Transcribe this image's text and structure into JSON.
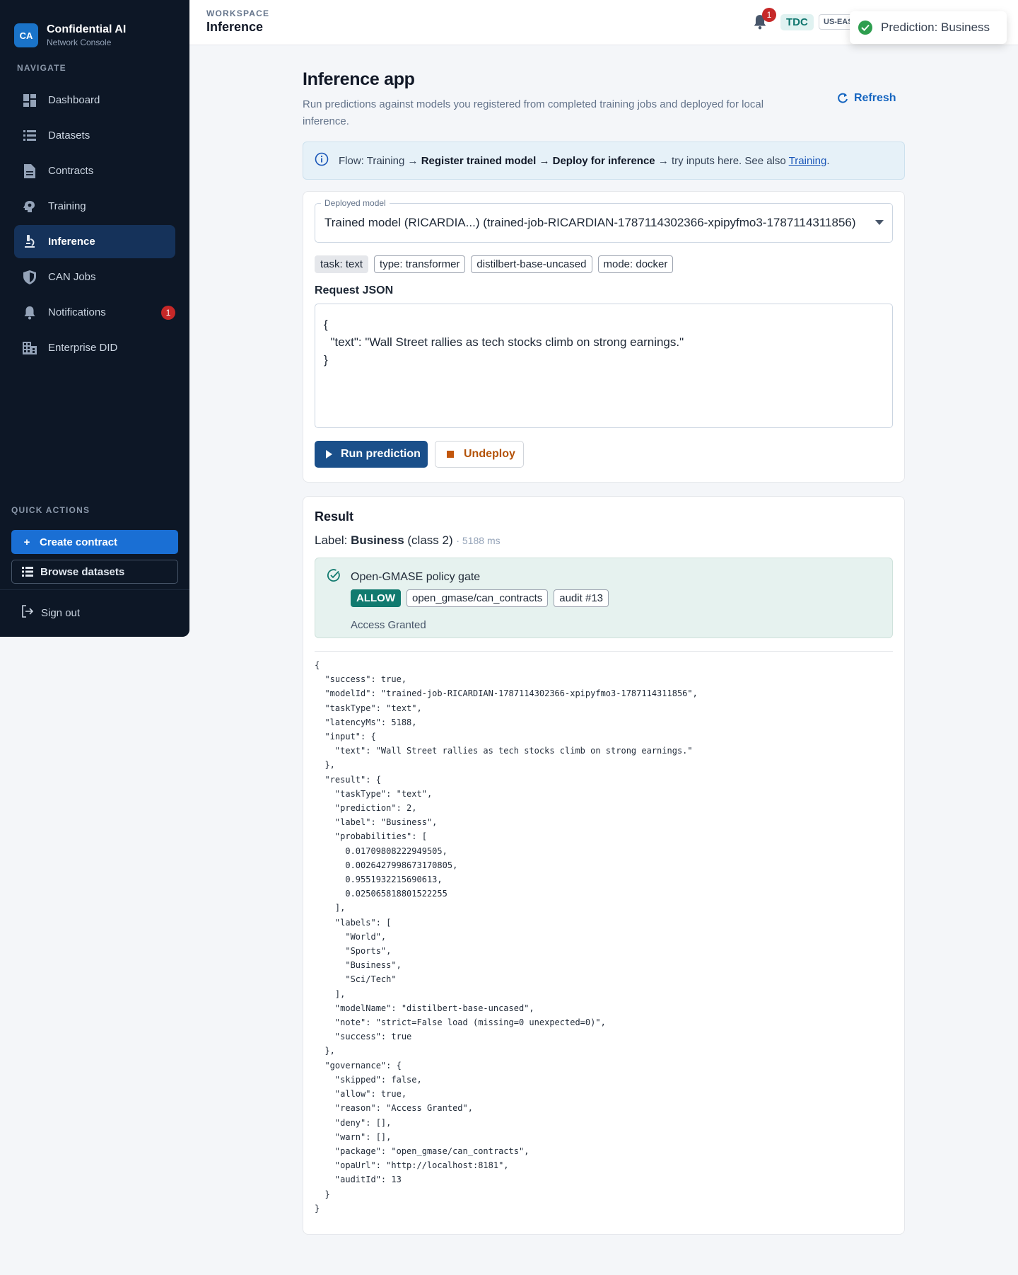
{
  "sidebar": {
    "logo": "CA",
    "brand_title": "Confidential AI",
    "brand_sub": "Network Console",
    "nav_label": "NAVIGATE",
    "items": [
      {
        "label": "Dashboard",
        "icon": "dashboard-icon"
      },
      {
        "label": "Datasets",
        "icon": "list-icon"
      },
      {
        "label": "Contracts",
        "icon": "document-icon"
      },
      {
        "label": "Training",
        "icon": "brain-icon"
      },
      {
        "label": "Inference",
        "icon": "microscope-icon",
        "active": true
      },
      {
        "label": "CAN Jobs",
        "icon": "shield-icon"
      },
      {
        "label": "Notifications",
        "icon": "bell-icon",
        "badge": "1"
      },
      {
        "label": "Enterprise DID",
        "icon": "building-icon"
      }
    ],
    "quick_actions_label": "QUICK ACTIONS",
    "create_contract": "Create contract",
    "browse_datasets": "Browse datasets",
    "sign_out": "Sign out"
  },
  "topbar": {
    "workspace_label": "WORKSPACE",
    "workspace_title": "Inference",
    "notification_count": "1",
    "org": "TDC",
    "region": "US-EAST"
  },
  "toast": {
    "text": "Prediction: Business"
  },
  "page": {
    "title": "Inference app",
    "description": "Run predictions against models you registered from completed training jobs and deployed for local inference.",
    "refresh": "Refresh",
    "flow": {
      "prefix": "Flow: Training →",
      "step1": "Register trained model",
      "arrow": "→",
      "step2": "Deploy for inference",
      "suffix": "→ try inputs here. See also",
      "link": "Training",
      "end": "."
    }
  },
  "model": {
    "legend": "Deployed model",
    "selected": "Trained model (RICARDIA...) (trained-job-RICARDIAN-1787114302366-xpipyfmo3-1787114311856)",
    "chips": [
      "task: text",
      "type: transformer",
      "distilbert-base-uncased",
      "mode: docker"
    ]
  },
  "request": {
    "label": "Request JSON",
    "body": "{\n  \"text\": \"Wall Street rallies as tech stocks climb on strong earnings.\"\n}"
  },
  "actions": {
    "run": "Run prediction",
    "undeploy": "Undeploy"
  },
  "result": {
    "title": "Result",
    "label_prefix": "Label:",
    "label": "Business",
    "class": "(class 2)",
    "latency": "· 5188 ms",
    "policy": {
      "title": "Open-GMASE policy gate",
      "decision": "ALLOW",
      "package": "open_gmase/can_contracts",
      "audit": "audit #13",
      "reason": "Access Granted"
    },
    "json": "{\n  \"success\": true,\n  \"modelId\": \"trained-job-RICARDIAN-1787114302366-xpipyfmo3-1787114311856\",\n  \"taskType\": \"text\",\n  \"latencyMs\": 5188,\n  \"input\": {\n    \"text\": \"Wall Street rallies as tech stocks climb on strong earnings.\"\n  },\n  \"result\": {\n    \"taskType\": \"text\",\n    \"prediction\": 2,\n    \"label\": \"Business\",\n    \"probabilities\": [\n      0.01709808222949505,\n      0.0026427998673170805,\n      0.9551932215690613,\n      0.025065818801522255\n    ],\n    \"labels\": [\n      \"World\",\n      \"Sports\",\n      \"Business\",\n      \"Sci/Tech\"\n    ],\n    \"modelName\": \"distilbert-base-uncased\",\n    \"note\": \"strict=False load (missing=0 unexpected=0)\",\n    \"success\": true\n  },\n  \"governance\": {\n    \"skipped\": false,\n    \"allow\": true,\n    \"reason\": \"Access Granted\",\n    \"deny\": [],\n    \"warn\": [],\n    \"package\": \"open_gmase/can_contracts\",\n    \"opaUrl\": \"http://localhost:8181\",\n    \"auditId\": 13\n  }\n}"
  },
  "colors": {
    "sidebar_bg": "#0d1726",
    "accent": "#1a6fd4",
    "allow": "#117a6f",
    "danger": "#c62828"
  }
}
